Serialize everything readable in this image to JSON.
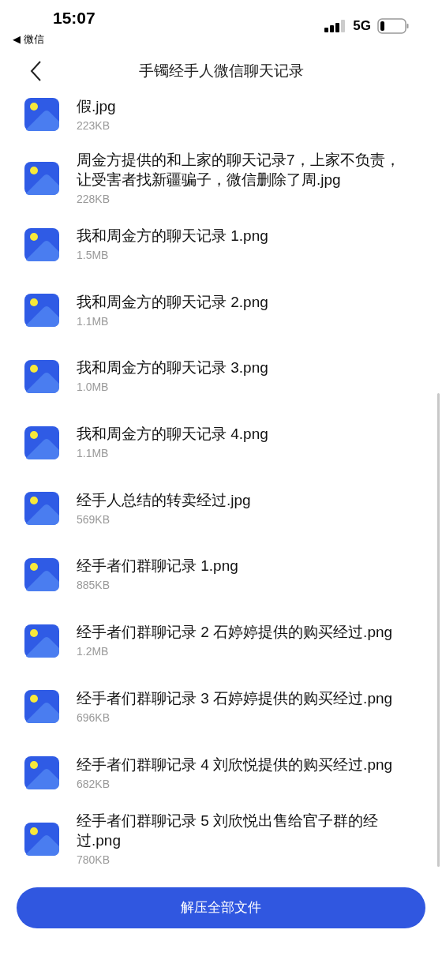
{
  "status_bar": {
    "time": "15:07",
    "back_app": "◀ 微信",
    "network": "5G"
  },
  "header": {
    "title": "手镯经手人微信聊天记录"
  },
  "files": [
    {
      "name": "假.jpg",
      "size": "223KB"
    },
    {
      "name": "周金方提供的和上家的聊天记录7，上家不负责，让受害者找新疆骗子，微信删除了周.jpg",
      "size": "228KB"
    },
    {
      "name": "我和周金方的聊天记录 1.png",
      "size": "1.5MB"
    },
    {
      "name": "我和周金方的聊天记录 2.png",
      "size": "1.1MB"
    },
    {
      "name": "我和周金方的聊天记录 3.png",
      "size": "1.0MB"
    },
    {
      "name": "我和周金方的聊天记录 4.png",
      "size": "1.1MB"
    },
    {
      "name": "经手人总结的转卖经过.jpg",
      "size": "569KB"
    },
    {
      "name": "经手者们群聊记录 1.png",
      "size": "885KB"
    },
    {
      "name": "经手者们群聊记录 2 石婷婷提供的购买经过.png",
      "size": "1.2MB"
    },
    {
      "name": "经手者们群聊记录 3 石婷婷提供的购买经过.png",
      "size": "696KB"
    },
    {
      "name": "经手者们群聊记录 4 刘欣悦提供的购买经过.png",
      "size": "682KB"
    },
    {
      "name": "经手者们群聊记录 5 刘欣悦出售给官子群的经过.png",
      "size": "780KB"
    }
  ],
  "button": "解压全部文件"
}
